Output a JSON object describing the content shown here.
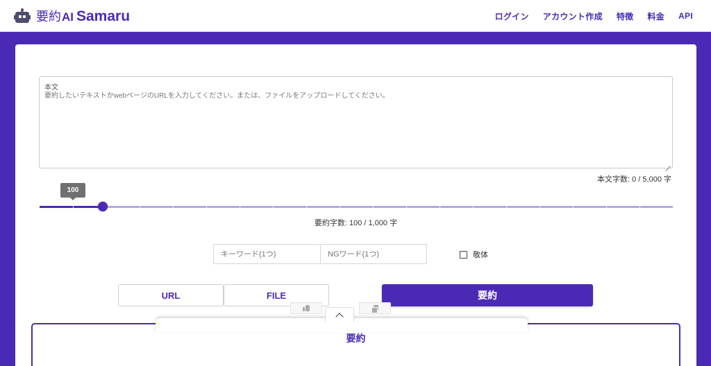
{
  "header": {
    "logo_jp": "要約",
    "logo_ai": "AI",
    "logo_en": "Samaru",
    "nav": [
      {
        "label": "ログイン"
      },
      {
        "label": "アカウント作成"
      },
      {
        "label": "特徴"
      },
      {
        "label": "料金"
      },
      {
        "label": "API"
      }
    ]
  },
  "form": {
    "body_label": "本文",
    "body_placeholder": "要約したいテキストかwebページのURLを入力してください。または、ファイルをアップロードしてください。",
    "body_char_count": "本文字数: 0 / 5,000 字",
    "slider": {
      "tooltip": "100",
      "value": 100,
      "min": 0,
      "max": 1000,
      "ticks": 19
    },
    "summary_char_count": "要約字数: 100 / 1,000 字",
    "keyword_placeholder": "キーワード(1つ)",
    "ng_placeholder": "NGワード(1つ)",
    "polite_label": "敬体",
    "url_button": "URL",
    "file_button": "FILE",
    "summarize_button": "要約"
  },
  "result": {
    "title": "要約"
  },
  "icons": {
    "like": "thumbs-up-icon",
    "copy": "copy-icon",
    "collapse": "chevron-up-icon"
  },
  "colors": {
    "brand": "#4a2ab5",
    "rail": "#b3a8e3"
  }
}
